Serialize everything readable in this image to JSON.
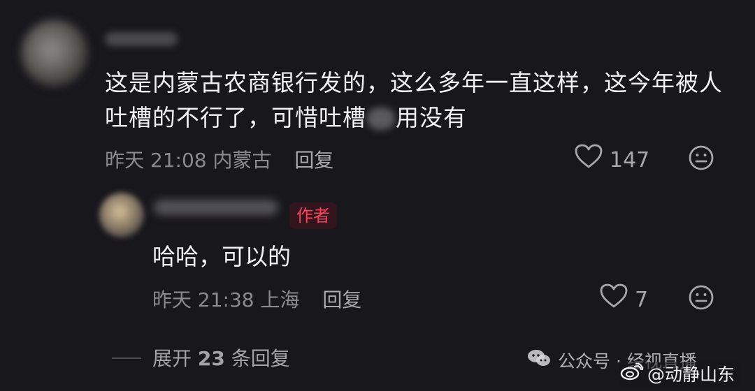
{
  "comment": {
    "text_part1": "这是内蒙古农商银行发的，这么多年一直这样，这今年被人吐槽的不行了，可惜吐槽",
    "text_part2": "用没有",
    "time": "昨天 21:08",
    "location": "内蒙古",
    "reply_label": "回复",
    "like_count": "147"
  },
  "reply": {
    "author_badge": "作者",
    "text": "哈哈，可以的",
    "time": "昨天 21:38",
    "location": "上海",
    "reply_label": "回复",
    "like_count": "7"
  },
  "replies": {
    "prefix": "展开 ",
    "count": "23",
    "suffix": " 条回复"
  },
  "watermarks": {
    "wechat": "公众号 · 经视直播",
    "weibo": "@动静山东"
  },
  "icons": {
    "like": "heart-icon",
    "emoji": "emoji-icon",
    "wechat": "wechat-icon",
    "weibo": "weibo-icon"
  },
  "colors": {
    "background": "#18171c",
    "text_primary": "#f3f3f5",
    "text_secondary": "#8a8a90",
    "author_badge": "#ff425b"
  }
}
